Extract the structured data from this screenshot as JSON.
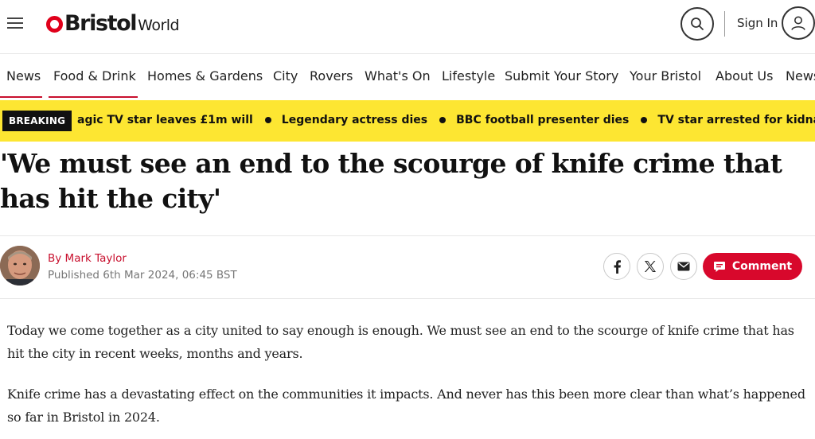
{
  "header": {
    "logo_bristol": "Bristol",
    "logo_world": "World",
    "signin_label": "Sign In",
    "accent_color": "#e0001b"
  },
  "nav": {
    "items": [
      "News",
      "Food & Drink",
      "Homes & Gardens",
      "City",
      "Rovers",
      "What's On",
      "Lifestyle",
      "Submit Your Story",
      "Your Bristol",
      "About Us",
      "News"
    ]
  },
  "breaking": {
    "label": "BREAKING",
    "items": [
      "agic TV star leaves £1m will",
      "Legendary actress dies",
      "BBC football presenter dies",
      "TV star arrested for kidnap and robbery"
    ],
    "bg_color": "#fde632"
  },
  "article": {
    "headline": "'We must see an end to the scourge of knife crime that has hit the city'",
    "byline_prefix": "By ",
    "author": "Mark Taylor",
    "published": "Published 6th Mar 2024, 06:45 BST",
    "comment_label": "Comment",
    "paragraphs": [
      "Today we come together as a city united to say enough is enough. We must see an end to the scourge of knife crime that has hit the city in recent weeks, months and years.",
      "Knife crime has a devastating effect on the communities it impacts. And never has this been more clear than what’s happened so far in Bristol in 2024."
    ]
  }
}
